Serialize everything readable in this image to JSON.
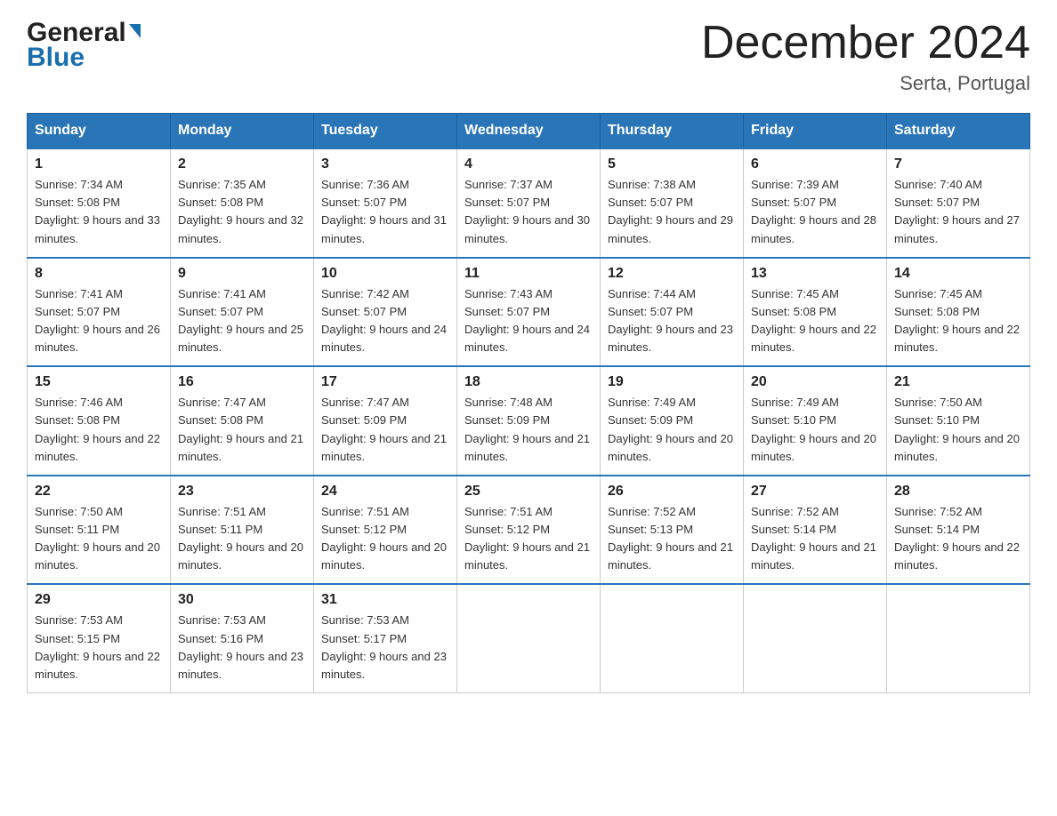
{
  "header": {
    "logo_general": "General",
    "logo_blue": "Blue",
    "month_title": "December 2024",
    "location": "Serta, Portugal"
  },
  "columns": [
    "Sunday",
    "Monday",
    "Tuesday",
    "Wednesday",
    "Thursday",
    "Friday",
    "Saturday"
  ],
  "weeks": [
    [
      {
        "day": "1",
        "sunrise": "7:34 AM",
        "sunset": "5:08 PM",
        "daylight": "9 hours and 33 minutes."
      },
      {
        "day": "2",
        "sunrise": "7:35 AM",
        "sunset": "5:08 PM",
        "daylight": "9 hours and 32 minutes."
      },
      {
        "day": "3",
        "sunrise": "7:36 AM",
        "sunset": "5:07 PM",
        "daylight": "9 hours and 31 minutes."
      },
      {
        "day": "4",
        "sunrise": "7:37 AM",
        "sunset": "5:07 PM",
        "daylight": "9 hours and 30 minutes."
      },
      {
        "day": "5",
        "sunrise": "7:38 AM",
        "sunset": "5:07 PM",
        "daylight": "9 hours and 29 minutes."
      },
      {
        "day": "6",
        "sunrise": "7:39 AM",
        "sunset": "5:07 PM",
        "daylight": "9 hours and 28 minutes."
      },
      {
        "day": "7",
        "sunrise": "7:40 AM",
        "sunset": "5:07 PM",
        "daylight": "9 hours and 27 minutes."
      }
    ],
    [
      {
        "day": "8",
        "sunrise": "7:41 AM",
        "sunset": "5:07 PM",
        "daylight": "9 hours and 26 minutes."
      },
      {
        "day": "9",
        "sunrise": "7:41 AM",
        "sunset": "5:07 PM",
        "daylight": "9 hours and 25 minutes."
      },
      {
        "day": "10",
        "sunrise": "7:42 AM",
        "sunset": "5:07 PM",
        "daylight": "9 hours and 24 minutes."
      },
      {
        "day": "11",
        "sunrise": "7:43 AM",
        "sunset": "5:07 PM",
        "daylight": "9 hours and 24 minutes."
      },
      {
        "day": "12",
        "sunrise": "7:44 AM",
        "sunset": "5:07 PM",
        "daylight": "9 hours and 23 minutes."
      },
      {
        "day": "13",
        "sunrise": "7:45 AM",
        "sunset": "5:08 PM",
        "daylight": "9 hours and 22 minutes."
      },
      {
        "day": "14",
        "sunrise": "7:45 AM",
        "sunset": "5:08 PM",
        "daylight": "9 hours and 22 minutes."
      }
    ],
    [
      {
        "day": "15",
        "sunrise": "7:46 AM",
        "sunset": "5:08 PM",
        "daylight": "9 hours and 22 minutes."
      },
      {
        "day": "16",
        "sunrise": "7:47 AM",
        "sunset": "5:08 PM",
        "daylight": "9 hours and 21 minutes."
      },
      {
        "day": "17",
        "sunrise": "7:47 AM",
        "sunset": "5:09 PM",
        "daylight": "9 hours and 21 minutes."
      },
      {
        "day": "18",
        "sunrise": "7:48 AM",
        "sunset": "5:09 PM",
        "daylight": "9 hours and 21 minutes."
      },
      {
        "day": "19",
        "sunrise": "7:49 AM",
        "sunset": "5:09 PM",
        "daylight": "9 hours and 20 minutes."
      },
      {
        "day": "20",
        "sunrise": "7:49 AM",
        "sunset": "5:10 PM",
        "daylight": "9 hours and 20 minutes."
      },
      {
        "day": "21",
        "sunrise": "7:50 AM",
        "sunset": "5:10 PM",
        "daylight": "9 hours and 20 minutes."
      }
    ],
    [
      {
        "day": "22",
        "sunrise": "7:50 AM",
        "sunset": "5:11 PM",
        "daylight": "9 hours and 20 minutes."
      },
      {
        "day": "23",
        "sunrise": "7:51 AM",
        "sunset": "5:11 PM",
        "daylight": "9 hours and 20 minutes."
      },
      {
        "day": "24",
        "sunrise": "7:51 AM",
        "sunset": "5:12 PM",
        "daylight": "9 hours and 20 minutes."
      },
      {
        "day": "25",
        "sunrise": "7:51 AM",
        "sunset": "5:12 PM",
        "daylight": "9 hours and 21 minutes."
      },
      {
        "day": "26",
        "sunrise": "7:52 AM",
        "sunset": "5:13 PM",
        "daylight": "9 hours and 21 minutes."
      },
      {
        "day": "27",
        "sunrise": "7:52 AM",
        "sunset": "5:14 PM",
        "daylight": "9 hours and 21 minutes."
      },
      {
        "day": "28",
        "sunrise": "7:52 AM",
        "sunset": "5:14 PM",
        "daylight": "9 hours and 22 minutes."
      }
    ],
    [
      {
        "day": "29",
        "sunrise": "7:53 AM",
        "sunset": "5:15 PM",
        "daylight": "9 hours and 22 minutes."
      },
      {
        "day": "30",
        "sunrise": "7:53 AM",
        "sunset": "5:16 PM",
        "daylight": "9 hours and 23 minutes."
      },
      {
        "day": "31",
        "sunrise": "7:53 AM",
        "sunset": "5:17 PM",
        "daylight": "9 hours and 23 minutes."
      },
      null,
      null,
      null,
      null
    ]
  ]
}
